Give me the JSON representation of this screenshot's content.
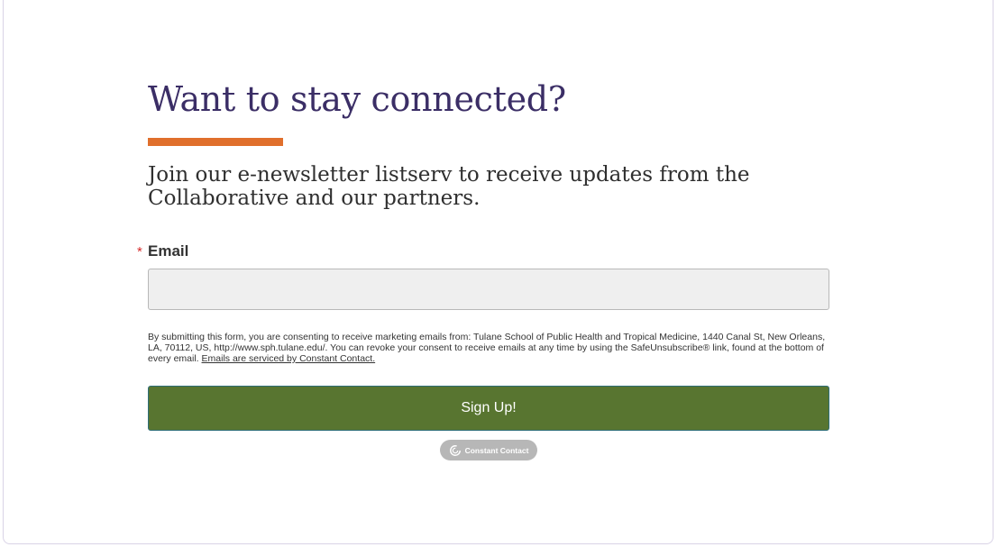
{
  "form": {
    "heading": "Want to stay connected?",
    "subheading": "Join our e-newsletter listserv to receive updates from the Collaborative and our partners.",
    "email": {
      "required_marker": "*",
      "label": "Email",
      "value": "",
      "placeholder": ""
    },
    "consent_text": "By submitting this form, you are consenting to receive marketing emails from: Tulane School of Public Health and Tropical Medicine, 1440 Canal St, New Orleans, LA, 70112, US, http://www.sph.tulane.edu/. You can revoke your consent to receive emails at any time by using the SafeUnsubscribe® link, found at the bottom of every email.",
    "consent_link": "Emails are serviced by Constant Contact.",
    "submit_label": "Sign Up!",
    "badge": {
      "text": "Constant Contact",
      "icon": "constant-contact-logo-icon"
    }
  },
  "colors": {
    "heading": "#3b2e66",
    "accent": "#e06f2c",
    "button": "#587530",
    "required": "#d62b2b",
    "badge": "#b7b7b7"
  }
}
